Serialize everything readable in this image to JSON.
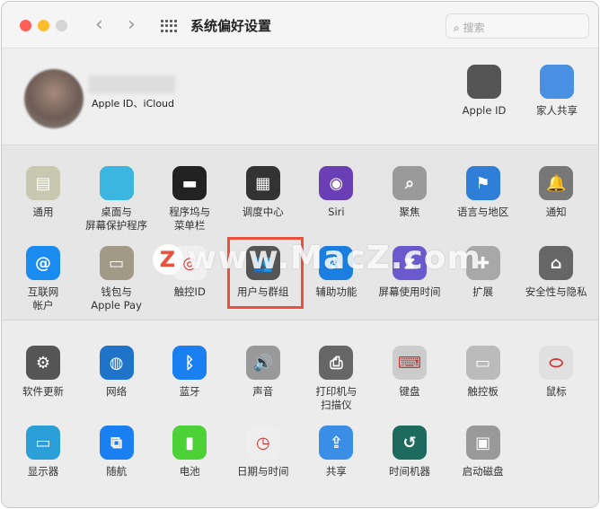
{
  "window": {
    "title": "系统偏好设置",
    "search_placeholder": "搜索",
    "back": "‹",
    "forward": "›"
  },
  "account": {
    "subtitle": "Apple ID、iCloud",
    "items": [
      {
        "label": "Apple ID",
        "icon": "apple-icon",
        "color": "#555555"
      },
      {
        "label": "家人共享",
        "icon": "family-icon",
        "color": "#4a90e2"
      }
    ]
  },
  "rows": [
    [
      {
        "label": "通用",
        "icon": "general-icon",
        "color": "#c8c8b0"
      },
      {
        "label": "桌面与\n屏幕保护程序",
        "icon": "desktop-icon",
        "color": "#3bb6e0"
      },
      {
        "label": "程序坞与\n菜单栏",
        "icon": "dock-icon",
        "color": "#222222"
      },
      {
        "label": "调度中心",
        "icon": "mission-control-icon",
        "color": "#333333"
      },
      {
        "label": "Siri",
        "icon": "siri-icon",
        "color": "#6a3fb5"
      },
      {
        "label": "聚焦",
        "icon": "spotlight-icon",
        "color": "#9a9a9a"
      },
      {
        "label": "语言与地区",
        "icon": "language-icon",
        "color": "#2f7ed8"
      },
      {
        "label": "通知",
        "icon": "notifications-icon",
        "color": "#777777"
      }
    ],
    [
      {
        "label": "互联网\n帐户",
        "icon": "internet-accounts-icon",
        "color": "#1a8cf0"
      },
      {
        "label": "钱包与\nApple Pay",
        "icon": "wallet-icon",
        "color": "#a09a86"
      },
      {
        "label": "触控ID",
        "icon": "touch-id-icon",
        "color": "#f0f0f0"
      },
      {
        "label": "用户与群组",
        "icon": "users-groups-icon",
        "color": "#555555"
      },
      {
        "label": "辅助功能",
        "icon": "accessibility-icon",
        "color": "#1a7fe0"
      },
      {
        "label": "屏幕使用时间",
        "icon": "screen-time-icon",
        "color": "#6a5acd"
      },
      {
        "label": "扩展",
        "icon": "extensions-icon",
        "color": "#a8a8a8"
      },
      {
        "label": "安全性与隐私",
        "icon": "security-icon",
        "color": "#666666"
      }
    ],
    [
      {
        "label": "软件更新",
        "icon": "software-update-icon",
        "color": "#555555"
      },
      {
        "label": "网络",
        "icon": "network-icon",
        "color": "#1f73c9"
      },
      {
        "label": "蓝牙",
        "icon": "bluetooth-icon",
        "color": "#1a7ff0"
      },
      {
        "label": "声音",
        "icon": "sound-icon",
        "color": "#999999"
      },
      {
        "label": "打印机与\n扫描仪",
        "icon": "printer-icon",
        "color": "#666666"
      },
      {
        "label": "键盘",
        "icon": "keyboard-icon",
        "color": "#cccccc"
      },
      {
        "label": "触控板",
        "icon": "trackpad-icon",
        "color": "#bbbbbb"
      },
      {
        "label": "鼠标",
        "icon": "mouse-icon",
        "color": "#e0e0e0"
      }
    ],
    [
      {
        "label": "显示器",
        "icon": "displays-icon",
        "color": "#2a9fd8"
      },
      {
        "label": "随航",
        "icon": "sidecar-icon",
        "color": "#1a7ff0"
      },
      {
        "label": "电池",
        "icon": "battery-icon",
        "color": "#4cd137"
      },
      {
        "label": "日期与时间",
        "icon": "date-time-icon",
        "color": "#eeeeee"
      },
      {
        "label": "共享",
        "icon": "sharing-icon",
        "color": "#3a8ee6"
      },
      {
        "label": "时间机器",
        "icon": "time-machine-icon",
        "color": "#1d6b5e"
      },
      {
        "label": "启动磁盘",
        "icon": "startup-disk-icon",
        "color": "#999999"
      },
      {
        "label": "",
        "icon": "",
        "color": ""
      }
    ]
  ],
  "glyphs": {
    "general-icon": "▤",
    "desktop-icon": "",
    "dock-icon": "▬",
    "mission-control-icon": "▦",
    "siri-icon": "◉",
    "spotlight-icon": "⌕",
    "language-icon": "⚑",
    "notifications-icon": "🔔",
    "internet-accounts-icon": "@",
    "wallet-icon": "▭",
    "touch-id-icon": "◎",
    "users-groups-icon": "👥",
    "accessibility-icon": "♿",
    "screen-time-icon": "⧗",
    "extensions-icon": "✚",
    "security-icon": "⌂",
    "software-update-icon": "⚙",
    "network-icon": "◍",
    "bluetooth-icon": "ᛒ",
    "sound-icon": "🔊",
    "printer-icon": "⎙",
    "keyboard-icon": "⌨",
    "trackpad-icon": "▭",
    "mouse-icon": "⬭",
    "displays-icon": "▭",
    "sidecar-icon": "⧉",
    "battery-icon": "▮",
    "date-time-icon": "◷",
    "sharing-icon": "⇪",
    "time-machine-icon": "↺",
    "startup-disk-icon": "▣"
  },
  "watermark": {
    "logo": "Z",
    "text": "www.MacZ.com"
  },
  "highlight_color": "#e8513d"
}
